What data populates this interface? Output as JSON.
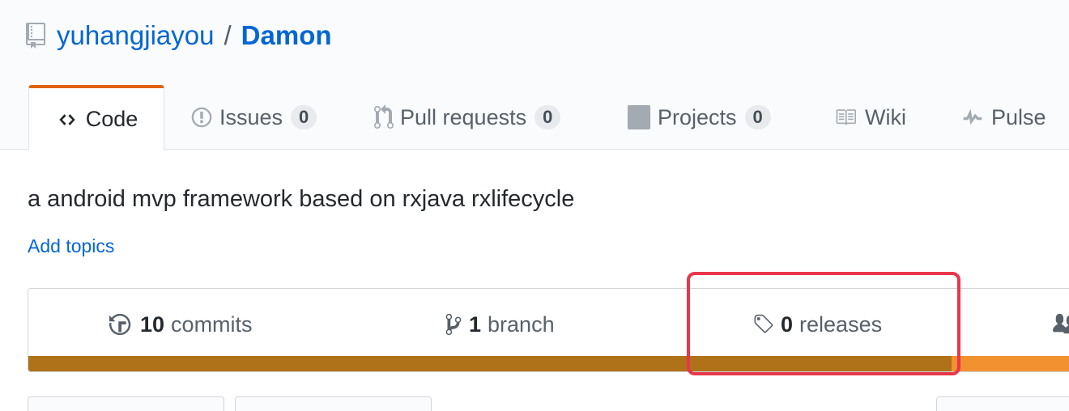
{
  "repo": {
    "owner": "yuhangjiayou",
    "separator": "/",
    "name": "Damon",
    "icon": "repo-icon"
  },
  "tabs": [
    {
      "label": "Code",
      "icon": "code-icon",
      "selected": true
    },
    {
      "label": "Issues",
      "icon": "issue-icon",
      "count": "0"
    },
    {
      "label": "Pull requests",
      "icon": "pull-request-icon",
      "count": "0"
    },
    {
      "label": "Projects",
      "icon": "project-icon",
      "count": "0"
    },
    {
      "label": "Wiki",
      "icon": "book-icon"
    },
    {
      "label": "Pulse",
      "icon": "pulse-icon"
    }
  ],
  "description": "a android mvp framework based on rxjava rxlifecycle",
  "add_topics": "Add topics",
  "summary": {
    "commits": {
      "count": "10",
      "label": "commits",
      "icon": "history-icon"
    },
    "branches": {
      "count": "1",
      "label": "branch",
      "icon": "git-branch-icon"
    },
    "releases": {
      "count": "0",
      "label": "releases",
      "icon": "tag-icon"
    },
    "contributors": {
      "icon": "people-icon"
    }
  },
  "colors": {
    "accent": "#e36209",
    "link": "#0366d6",
    "lang_primary": "#b07219",
    "lang_secondary": "#f1912f",
    "highlight": "#e8364a"
  }
}
